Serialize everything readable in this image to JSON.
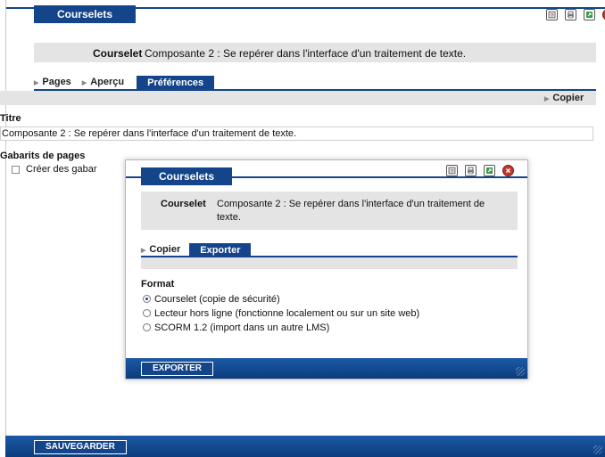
{
  "outer": {
    "window_title": "Courselets",
    "courselet_label": "Courselet",
    "courselet_value": "Composante 2 : Se repérer dans l'interface d'un traitement de texte.",
    "tabs": [
      {
        "label": "Pages"
      },
      {
        "label": "Aperçu"
      },
      {
        "label": "Préférences"
      }
    ],
    "copy_link": "Copier",
    "titre_label": "Titre",
    "titre_value": "Composante 2 : Se repérer dans l'interface d'un traitement de texte.",
    "gabarits_label": "Gabarits de pages",
    "gabarits_checkbox": "Créer des gabar",
    "save_button": "SAUVEGARDER",
    "icons": [
      "help-icon",
      "print-icon",
      "export-icon",
      "close-icon"
    ]
  },
  "dialog": {
    "window_title": "Courselets",
    "courselet_label": "Courselet",
    "courselet_value_line1": "Composante 2 : Se repérer dans l'interface d'un traitement de",
    "courselet_value_line2": "texte.",
    "tabs": [
      {
        "label": "Copier"
      },
      {
        "label": "Exporter"
      }
    ],
    "format_label": "Format",
    "options": [
      {
        "label": "Courselet (copie de sécurité)",
        "selected": true
      },
      {
        "label": "Lecteur hors ligne (fonctionne localement ou sur un site web)",
        "selected": false
      },
      {
        "label": "SCORM 1.2 (import dans un autre LMS)",
        "selected": false
      }
    ],
    "export_button": "EXPORTER"
  },
  "colors": {
    "brand": "#14458a",
    "close": "#c0392b",
    "grey_bar": "#e4e4e4"
  }
}
